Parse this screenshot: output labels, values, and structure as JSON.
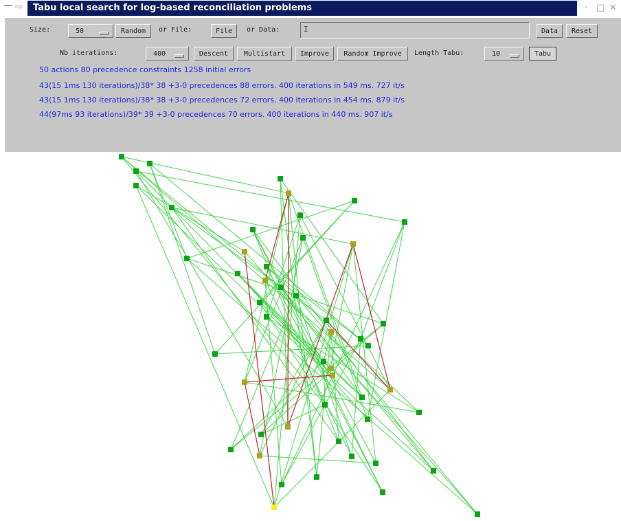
{
  "window": {
    "title": "Tabu local search for log-based reconciliation problems",
    "accent_color": "#0a1a5c",
    "icons": [
      "window-menu-icon",
      "pin-icon",
      "minimize-icon",
      "maximize-icon",
      "close-icon"
    ]
  },
  "row1": {
    "size_label": "Size:",
    "size_value": "50",
    "random_label": "Random",
    "or_file_label": "or File:",
    "file_label": "File",
    "or_data_label": "or Data:",
    "data_input_value": "",
    "data_label": "Data",
    "reset_label": "Reset"
  },
  "row2": {
    "nb_iterations_label": "Nb iterations:",
    "nb_iterations_value": "400",
    "descent_label": "Descent",
    "multistart_label": "Multistart",
    "improve_label": "Improve",
    "random_improve_label": "Random Improve",
    "length_tabu_label": "Length Tabu:",
    "length_tabu_value": "10",
    "tabu_label": "Tabu"
  },
  "status": {
    "color": "#1a2be0",
    "lines": [
      "50 actions  80 precedence constraints 1258 initial errors",
      "43(15 1ms 130 iterations)/38* 38 +3-0 precedences 88 errors. 400 iterations in 549 ms.      727 it/s",
      "43(15 1ms 130 iterations)/38* 38 +3-0 precedences 72 errors. 400 iterations in 454 ms.      879 it/s",
      "44(97ms 93 iterations)/39* 39 +3-0 precedences 70 errors. 400 iterations in 440 ms.      907 it/s"
    ]
  },
  "graph": {
    "edge_color": "#44d24a",
    "violated_edge_color": "#c0303a",
    "node_color": "#0da318",
    "conflict_node_color": "#b0a020",
    "highlight_node_color": "#f4f41a"
  }
}
